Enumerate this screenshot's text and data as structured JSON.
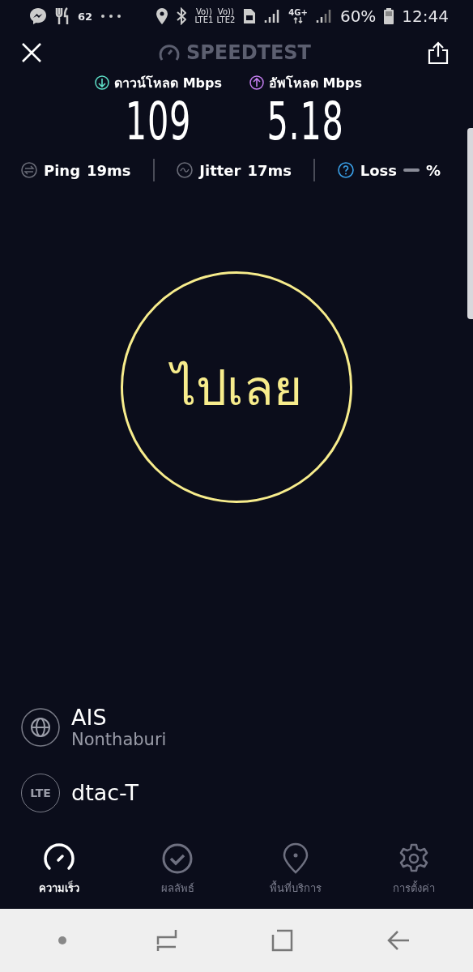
{
  "status_bar": {
    "notification_count": "62",
    "sims": [
      {
        "voice": "Vo))",
        "network": "LTE1"
      },
      {
        "voice": "Vo))",
        "network": "LTE2"
      }
    ],
    "network_type": "4G+",
    "battery": "60%",
    "time": "12:44"
  },
  "header": {
    "logo": "SPEEDTEST"
  },
  "results": [
    {
      "kind": "download",
      "label": "ดาวน์โหลด",
      "unit": "Mbps",
      "value": "109",
      "color": "#5ee0c8"
    },
    {
      "kind": "upload",
      "label": "อัพโหลด",
      "unit": "Mbps",
      "value": "5.18",
      "color": "#c47ef0"
    }
  ],
  "stats": [
    {
      "kind": "ping",
      "label": "Ping",
      "value": "19ms"
    },
    {
      "kind": "jitter",
      "label": "Jitter",
      "value": "17ms"
    },
    {
      "kind": "loss",
      "label": "Loss",
      "value": "%"
    }
  ],
  "go_button": {
    "label": "ไปเลย"
  },
  "connection": [
    {
      "kind": "server",
      "name": "AIS",
      "location": "Nonthaburi"
    },
    {
      "kind": "carrier",
      "name": "dtac-T",
      "badge": "LTE"
    }
  ],
  "tabs": [
    {
      "kind": "speed",
      "label": "ความเร็ว",
      "selected": true
    },
    {
      "kind": "results",
      "label": "ผลลัพธ์",
      "selected": false
    },
    {
      "kind": "map",
      "label": "พื้นที่บริการ",
      "selected": false
    },
    {
      "kind": "settings",
      "label": "การตั้งค่า",
      "selected": false
    }
  ]
}
